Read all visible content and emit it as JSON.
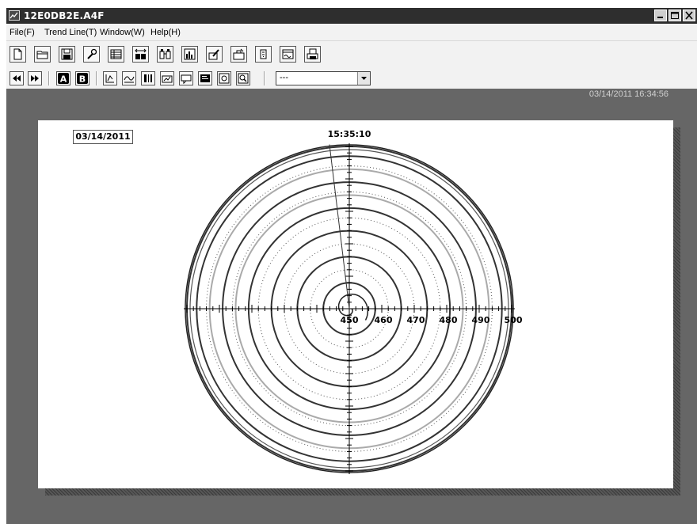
{
  "window": {
    "title": "12E0DB2E.A4F",
    "icon": "chart-icon",
    "controls": [
      "minimize",
      "maximize",
      "close"
    ]
  },
  "menu": [
    {
      "label": "File(F)",
      "id": "file"
    },
    {
      "label": "Trend Line(T)",
      "id": "trend-line"
    },
    {
      "label": "Window(W)",
      "id": "window"
    },
    {
      "label": "Help(H)",
      "id": "help"
    }
  ],
  "toolbar1": [
    "new-file-icon",
    "open-folder-icon",
    "save-disk-icon",
    "wrench-icon",
    "table-view-icon",
    "ab-compare-icon",
    "binoculars-icon",
    "bar-chart-icon",
    "edit-note-icon",
    "tool-box-icon",
    "alarm-icon",
    "waveform-icon",
    "print-icon"
  ],
  "toolbar2": {
    "nav": [
      "rewind-icon",
      "fast-forward-icon"
    ],
    "cursors": [
      "A",
      "B"
    ],
    "tools": [
      "scale-icon",
      "trend-wave-icon",
      "columns-icon",
      "chart-edit-icon",
      "message-icon",
      "note-icon",
      "settings-icon",
      "zoom-chart-icon"
    ],
    "dropdown_value": "---"
  },
  "status": {
    "timestamp": "03/14/2011 16:34:56"
  },
  "chart": {
    "date": "03/14/2011",
    "time": "15:35:10"
  },
  "chart_data": {
    "type": "polar",
    "radial_tick_labels": [
      "450",
      "460",
      "470",
      "480",
      "490",
      "500"
    ],
    "radial_range": [
      450,
      500
    ],
    "series": [
      {
        "values_description": "spiral from center outward",
        "color": "#333333",
        "rings_at": [
          458,
          466,
          474,
          481,
          489,
          497,
          500
        ]
      },
      {
        "color": "#aaaaaa",
        "rings_at": [
          485,
          493
        ]
      },
      {
        "style": "dotted",
        "color": "#555555",
        "rings_at": [
          462,
          470,
          478,
          486,
          494
        ]
      }
    ],
    "time_cursor": "15:35:10",
    "grid": true
  },
  "colors": {
    "titlebar": "#2e2e2e",
    "workspace": "#666666",
    "chart_background": "#ffffff",
    "ring_dark": "#333333",
    "ring_light": "#aaaaaa"
  }
}
